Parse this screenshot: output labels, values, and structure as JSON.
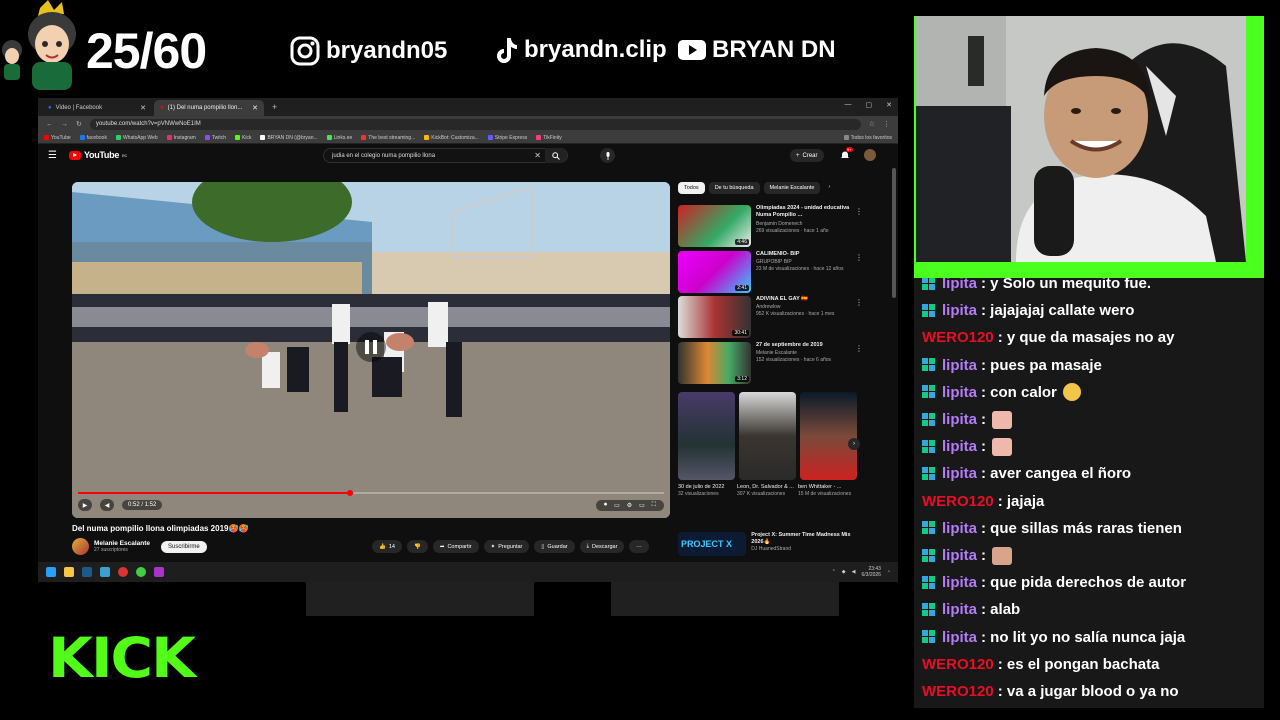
{
  "overlay": {
    "counter": "25/60",
    "instagram": "bryandn05",
    "tiktok": "bryandn.clip",
    "youtube": "BRYAN DN",
    "kick_logo": "KICK"
  },
  "browser": {
    "tabs": [
      {
        "label": "Video | Facebook",
        "active": false
      },
      {
        "label": "(1) Del numa pompilio llon...",
        "active": true
      }
    ],
    "url": "youtube.com/watch?v=pVNWwNoE1IM",
    "bookmarks": [
      "YouTube",
      "facebook",
      "WhatsApp Web",
      "Instagram",
      "Twitch",
      "Kick",
      "BRYAN DN (@bryan...",
      "Links.ee",
      "The best streaming...",
      "KickBot: Customiza...",
      "Stripe Express",
      "TikFinity"
    ],
    "bookmarks_right": "Todos los favoritos"
  },
  "youtube": {
    "logo": "YouTube",
    "logo_region": "EC",
    "search_value": "judia en el colegio numa pompilio llona",
    "create_label": "Crear",
    "notifications": "9+",
    "video": {
      "title": "Del numa pompilio llona olimpiadas 2019🥵🥵",
      "time": "0:52 / 1:52",
      "progress": 0.464,
      "channel": "Melanie Escalante",
      "subscribers": "27 suscriptores",
      "subscribe_label": "Suscribirme",
      "likes": "14",
      "share_label": "Compartir",
      "ask_label": "Preguntar",
      "save_label": "Guardar",
      "download_label": "Descargar"
    },
    "chips": [
      "Todos",
      "De tu búsqueda",
      "Melanie Escalante"
    ],
    "recommendations": [
      {
        "title": "Olimpiadas 2024 - unidad educativa Numa Pompilio ...",
        "channel": "Benjamin Domenech",
        "meta": "269 visualizaciones · hace 1 año",
        "duration": "4:46"
      },
      {
        "title": "CALIMENIO- BIP",
        "channel": "GRUPOBIP BIP",
        "meta": "23 M de visualizaciones · hace 12 años",
        "duration": "2:41"
      },
      {
        "title": "ADIVINA EL GAY 🇪🇸",
        "channel": "Andrewlow",
        "meta": "952 K visualizaciones · hace 1 mes",
        "duration": "30:41"
      },
      {
        "title": "27 de septiembre de 2019",
        "channel": "Melanie Escalante",
        "meta": "152 visualizaciones · hace 6 años",
        "duration": "3:12"
      }
    ],
    "shorts": [
      {
        "title": "30 de julio de 2022",
        "views": "32 visualizaciones"
      },
      {
        "title": "Leon, Dr. Salvador & ...",
        "views": "307 K visualizaciones"
      },
      {
        "title": "ben Whittaker - ...",
        "views": "15 M de visualizaciones"
      }
    ],
    "last_rec": {
      "thumb_text": "PROJECT X",
      "title": "Project X: Summer Time Madness Mix 2026🔥",
      "channel": "DJ HuanedStrand"
    }
  },
  "taskbar": {
    "time": "23:43",
    "date": "6/3/2026"
  },
  "chat": {
    "messages": [
      {
        "user": "lipita",
        "text": ": y Solo un mequito fue.",
        "emote": null
      },
      {
        "user": "lipita",
        "text": ": jajajajaj callate wero",
        "emote": null
      },
      {
        "user": "WERO120",
        "text": ": y que da masajes no ay",
        "emote": null
      },
      {
        "user": "lipita",
        "text": ": pues pa masaje",
        "emote": null
      },
      {
        "user": "lipita",
        "text": ": con calor",
        "emote": "blush-emote"
      },
      {
        "user": "lipita",
        "text": ":",
        "emote": "pink-emote"
      },
      {
        "user": "lipita",
        "text": ":",
        "emote": "pink-emote"
      },
      {
        "user": "lipita",
        "text": ": aver cangea el ñoro",
        "emote": null
      },
      {
        "user": "WERO120",
        "text": ": jajaja",
        "emote": null
      },
      {
        "user": "lipita",
        "text": ": que sillas más raras tienen",
        "emote": null
      },
      {
        "user": "lipita",
        "text": ":",
        "emote": "hand-emote"
      },
      {
        "user": "lipita",
        "text": ": que pida derechos de autor",
        "emote": null
      },
      {
        "user": "lipita",
        "text": ": alab",
        "emote": null
      },
      {
        "user": "lipita",
        "text": ": no lit yo no salía nunca jaja",
        "emote": null
      },
      {
        "user": "WERO120",
        "text": ": es el pongan bachata",
        "emote": null
      },
      {
        "user": "WERO120",
        "text": ": va a jugar blood o ya no",
        "emote": null
      }
    ]
  },
  "colors": {
    "kick_green": "#53fc18",
    "youtube_red": "#ff0000",
    "lipita": "#b57cf8",
    "wero": "#e0112b"
  }
}
